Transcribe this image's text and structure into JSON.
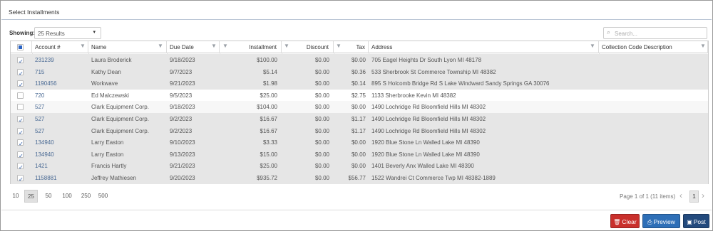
{
  "title": "Select Installments",
  "showing": {
    "label": "Showing:",
    "value": "25 Results"
  },
  "search": {
    "placeholder": "Search..."
  },
  "columns": {
    "account": "Account #",
    "name": "Name",
    "due_date": "Due Date",
    "installment": "Installment",
    "discount": "Discount",
    "tax": "Tax",
    "address": "Address",
    "collection": "Collection Code Description"
  },
  "rows": [
    {
      "checked": true,
      "account": "231239",
      "name": "Laura Broderick",
      "due_date": "9/18/2023",
      "installment": "$100.00",
      "discount": "$0.00",
      "tax": "$0.00",
      "address": "705 Eagel Heights Dr South Lyon MI 48178",
      "collection": ""
    },
    {
      "checked": true,
      "account": "715",
      "name": "Kathy Dean",
      "due_date": "9/7/2023",
      "installment": "$5.14",
      "discount": "$0.00",
      "tax": "$0.36",
      "address": "533 Sherbrook St Commerce Township MI 48382",
      "collection": ""
    },
    {
      "checked": true,
      "account": "1190456",
      "name": "Workwave",
      "due_date": "9/21/2023",
      "installment": "$1.98",
      "discount": "$0.00",
      "tax": "$0.14",
      "address": "895 S Holcomb Bridge Rd S Lake Windward Sandy Springs GA 30076",
      "collection": ""
    },
    {
      "checked": false,
      "account": "720",
      "name": "Ed Malczewski",
      "due_date": "9/5/2023",
      "installment": "$25.00",
      "discount": "$0.00",
      "tax": "$2.75",
      "address": "1133 Sherbrooke Kevin MI 48382",
      "collection": ""
    },
    {
      "checked": false,
      "account": "527",
      "name": "Clark Equipment Corp.",
      "due_date": "9/18/2023",
      "installment": "$104.00",
      "discount": "$0.00",
      "tax": "$0.00",
      "address": "1490 Lochridge Rd Bloomfield Hills MI 48302",
      "collection": ""
    },
    {
      "checked": true,
      "account": "527",
      "name": "Clark Equipment Corp.",
      "due_date": "9/2/2023",
      "installment": "$16.67",
      "discount": "$0.00",
      "tax": "$1.17",
      "address": "1490 Lochridge Rd Bloomfield Hills MI 48302",
      "collection": ""
    },
    {
      "checked": true,
      "account": "527",
      "name": "Clark Equipment Corp.",
      "due_date": "9/2/2023",
      "installment": "$16.67",
      "discount": "$0.00",
      "tax": "$1.17",
      "address": "1490 Lochridge Rd Bloomfield Hills MI 48302",
      "collection": ""
    },
    {
      "checked": true,
      "account": "134940",
      "name": "Larry Easton",
      "due_date": "9/10/2023",
      "installment": "$3.33",
      "discount": "$0.00",
      "tax": "$0.00",
      "address": "1920 Blue Stone Ln Walled Lake MI 48390",
      "collection": ""
    },
    {
      "checked": true,
      "account": "134940",
      "name": "Larry Easton",
      "due_date": "9/13/2023",
      "installment": "$15.00",
      "discount": "$0.00",
      "tax": "$0.00",
      "address": "1920 Blue Stone Ln Walled Lake MI 48390",
      "collection": ""
    },
    {
      "checked": true,
      "account": "1421",
      "name": "Francis Hartly",
      "due_date": "9/21/2023",
      "installment": "$25.00",
      "discount": "$0.00",
      "tax": "$0.00",
      "address": "1401 Beverly Anx Walled Lake MI 48390",
      "collection": ""
    },
    {
      "checked": true,
      "account": "1158881",
      "name": "Jeffrey Mathiesen",
      "due_date": "9/20/2023",
      "installment": "$935.72",
      "discount": "$0.00",
      "tax": "$56.77",
      "address": "1522 Wandrei Ct Commerce Twp MI 48382-1889",
      "collection": ""
    }
  ],
  "page_sizes": [
    "10",
    "25",
    "50",
    "100",
    "250",
    "500"
  ],
  "active_page_size": "25",
  "page_info": "Page 1 of 1 (11 items)",
  "current_page": "1",
  "buttons": {
    "clear": "Clear",
    "preview": "Preview",
    "post": "Post"
  },
  "colors": {
    "clear": "#c9302c",
    "preview": "#2e6fb7",
    "post": "#234a7d",
    "link": "#4a6a94",
    "selected_row": "#e6e6e6"
  }
}
